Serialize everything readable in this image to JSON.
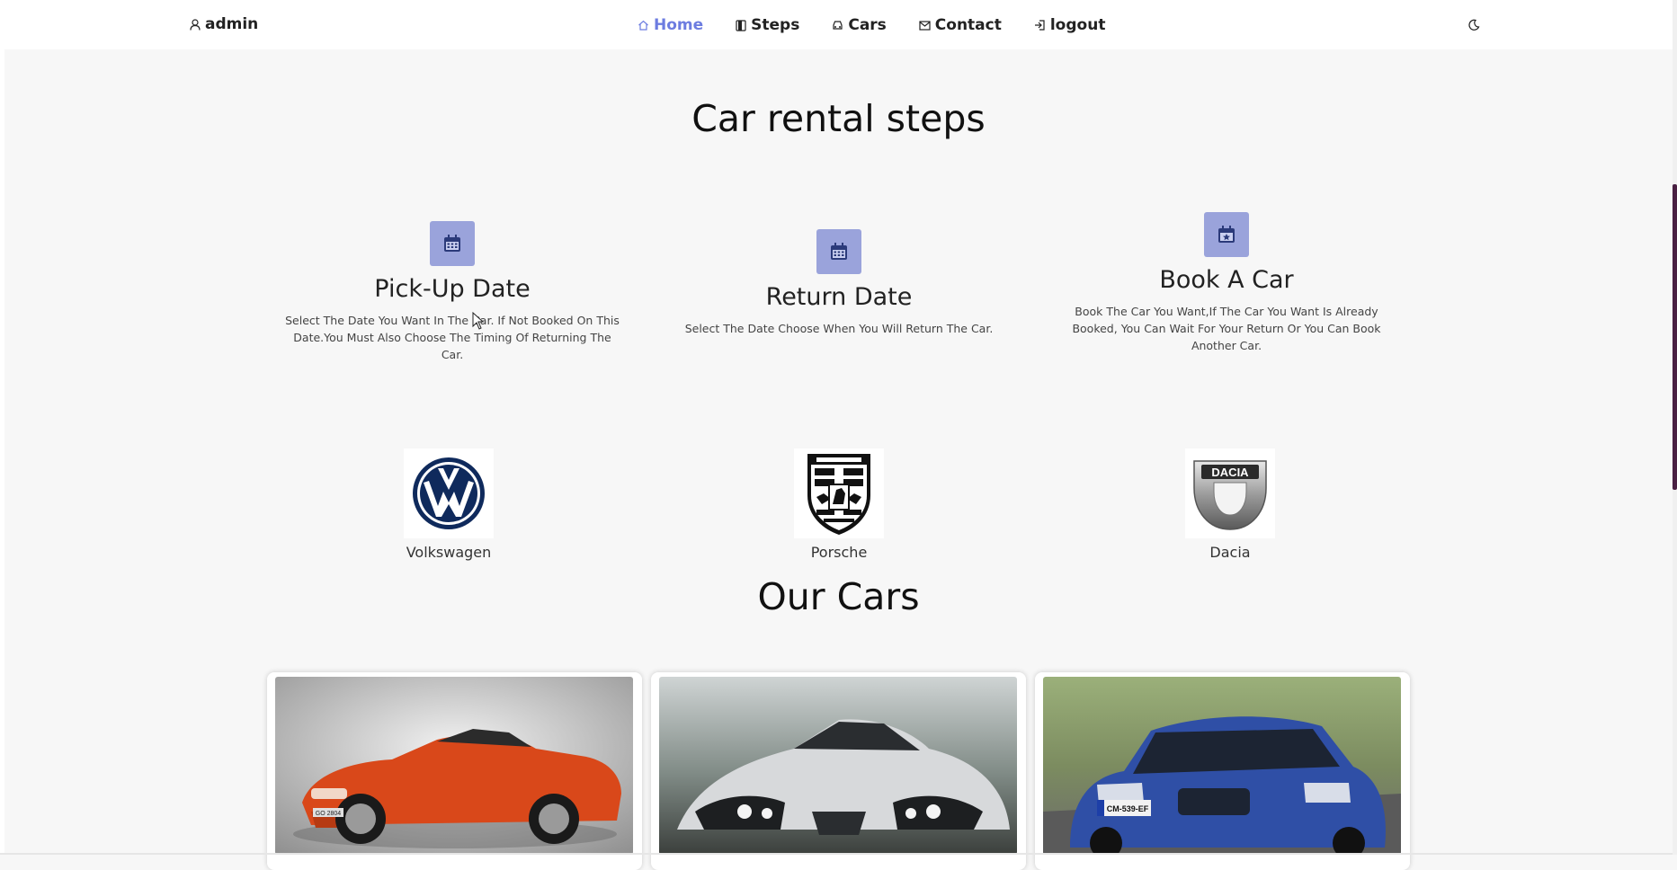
{
  "header": {
    "user_label": "admin",
    "nav": [
      {
        "label": "Home",
        "icon": "home-icon",
        "active": true
      },
      {
        "label": "Steps",
        "icon": "steps-icon",
        "active": false
      },
      {
        "label": "Cars",
        "icon": "car-icon",
        "active": false
      },
      {
        "label": "Contact",
        "icon": "mail-icon",
        "active": false
      },
      {
        "label": "logout",
        "icon": "logout-icon",
        "active": false
      }
    ],
    "theme_icon": "moon-icon"
  },
  "steps_section": {
    "title": "Car rental steps",
    "steps": [
      {
        "title": "Pick-Up Date",
        "desc": "Select The Date You Want In The Car. If Not Booked On This Date.You Must Also Choose The Timing Of Returning The Car.",
        "icon": "calendar-icon"
      },
      {
        "title": "Return Date",
        "desc": "Select The Date Choose When You Will Return The Car.",
        "icon": "calendar-icon"
      },
      {
        "title": "Book A Car",
        "desc": "Book The Car You Want,If The Car You Want Is Already Booked, You Can Wait For Your Return Or You Can Book Another Car.",
        "icon": "calendar-star-icon"
      }
    ]
  },
  "brands": [
    {
      "name": "Volkswagen",
      "logo": "volkswagen-logo"
    },
    {
      "name": "Porsche",
      "logo": "porsche-logo"
    },
    {
      "name": "Dacia",
      "logo": "dacia-logo",
      "logo_text": "DACIA"
    }
  ],
  "cars_section": {
    "title": "Our Cars",
    "cars": [
      {
        "image": "orange-roadster-photo",
        "plate": "GO 2804"
      },
      {
        "image": "silver-supercar-photo"
      },
      {
        "image": "blue-hatchback-photo",
        "plate": "CM-539-EF"
      }
    ]
  },
  "colors": {
    "accent": "#6c7ce0",
    "icon_bg": "#9aa3db",
    "icon_fg": "#2b3a7a",
    "page_bg": "#f7f7f7"
  }
}
